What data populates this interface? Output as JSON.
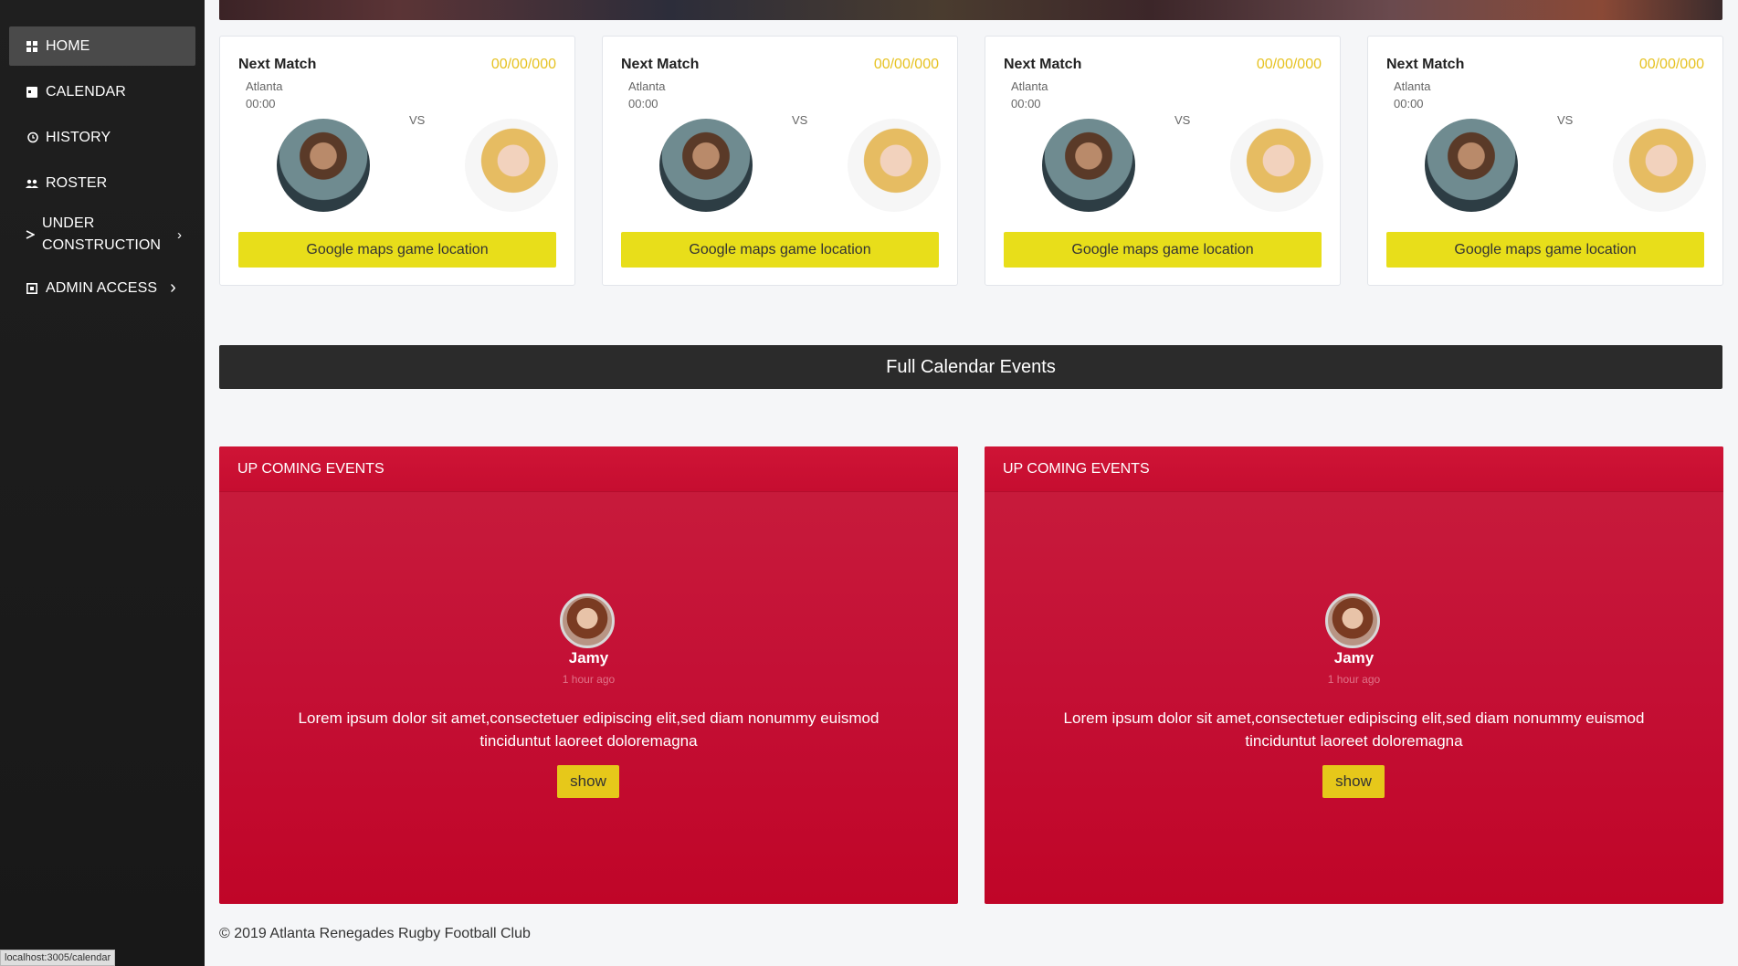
{
  "sidebar": {
    "items": [
      {
        "label": "HOME",
        "icon": "grid-icon"
      },
      {
        "label": "CALENDAR",
        "icon": "calendar-icon"
      },
      {
        "label": "HISTORY",
        "icon": "history-icon"
      },
      {
        "label": "ROSTER",
        "icon": "people-icon"
      },
      {
        "label_line1": "UNDER",
        "label_line2": "CONSTRUCTION",
        "icon": "play-icon",
        "chevron": "›"
      },
      {
        "label": "ADMIN ACCESS",
        "icon": "admin-icon",
        "chevron": "›"
      }
    ]
  },
  "matches": [
    {
      "title": "Next Match",
      "date": "00/00/000",
      "city": "Atlanta",
      "time": "00:00",
      "vs": "VS",
      "map_label": "Google maps game location"
    },
    {
      "title": "Next Match",
      "date": "00/00/000",
      "city": "Atlanta",
      "time": "00:00",
      "vs": "VS",
      "map_label": "Google maps game location"
    },
    {
      "title": "Next Match",
      "date": "00/00/000",
      "city": "Atlanta",
      "time": "00:00",
      "vs": "VS",
      "map_label": "Google maps game location"
    },
    {
      "title": "Next Match",
      "date": "00/00/000",
      "city": "Atlanta",
      "time": "00:00",
      "vs": "VS",
      "map_label": "Google maps game location"
    }
  ],
  "calendar_bar": {
    "label": "Full Calendar Events"
  },
  "events": [
    {
      "header": "UP COMING EVENTS",
      "name": "Jamy",
      "time": "1 hour ago",
      "text": "Lorem ipsum dolor sit amet,consectetuer edipiscing elit,sed diam nonummy euismod tinciduntut laoreet doloremagna",
      "button": "show"
    },
    {
      "header": "UP COMING EVENTS",
      "name": "Jamy",
      "time": "1 hour ago",
      "text": "Lorem ipsum dolor sit amet,consectetuer edipiscing elit,sed diam nonummy euismod tinciduntut laoreet doloremagna",
      "button": "show"
    }
  ],
  "footer": {
    "text": "© 2019 Atlanta Renegades Rugby Football Club"
  },
  "status_bar": {
    "url": "localhost:3005/calendar"
  },
  "colors": {
    "accent_yellow": "#e8de1a",
    "event_red": "#c41035",
    "sidebar_bg": "#1c1c1c",
    "date_yellow": "#e6c222"
  }
}
